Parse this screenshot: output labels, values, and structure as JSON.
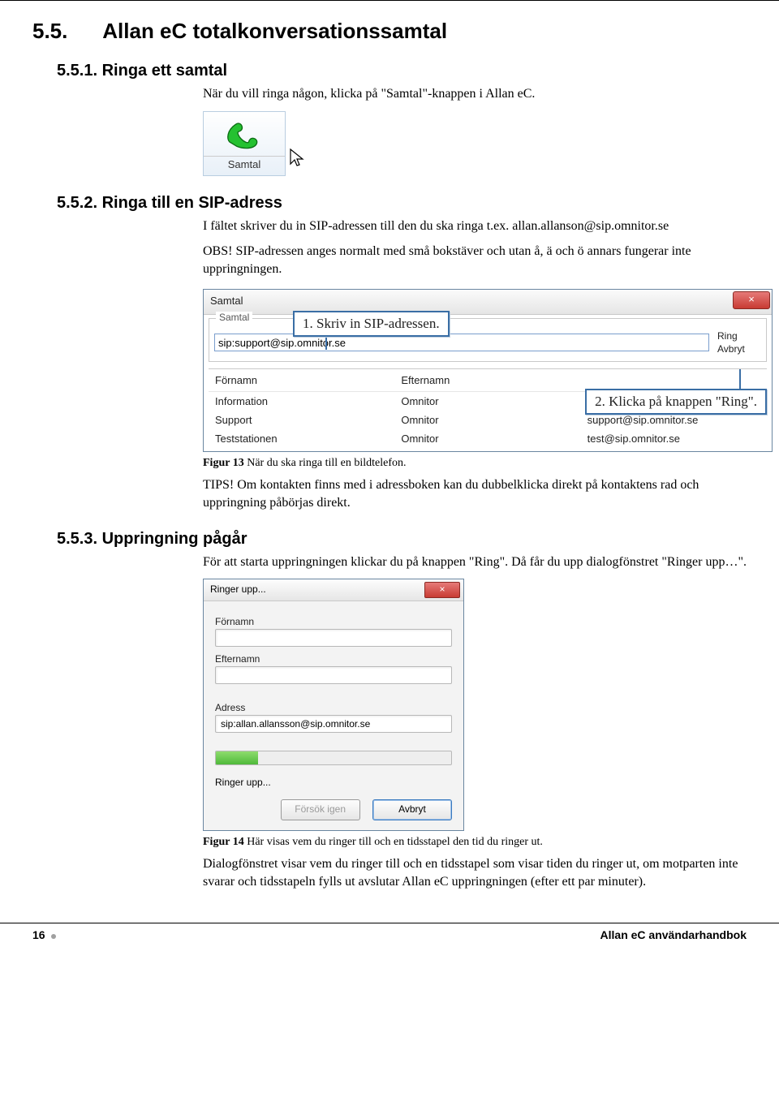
{
  "headings": {
    "h55_num": "5.5.",
    "h55_title": "Allan eC totalkonversationssamtal",
    "h551": "5.5.1. Ringa ett samtal",
    "h552": "5.5.2. Ringa till en SIP-adress",
    "h553": "5.5.3. Uppringning pågår"
  },
  "para": {
    "p1": "När du vill ringa någon, klicka på \"Samtal\"-knappen i Allan eC.",
    "p2a": "I fältet skriver du in SIP-adressen till den du ska ringa t.ex. allan.allanson@sip.omnitor.se",
    "p2b": "OBS! SIP-adressen anges normalt med små bokstäver och utan å, ä och ö annars fungerar inte uppringningen.",
    "tips": "TIPS! Om kontakten finns med i adressboken kan du dubbelklicka direkt på kontaktens rad och uppringning påbörjas direkt.",
    "p3": "För att starta uppringningen klickar du på knappen \"Ring\". Då får du upp dialogfönstret \"Ringer upp…\".",
    "fig13b": "Figur 13",
    "fig13": " När du ska ringa till en bildtelefon.",
    "fig14b": "Figur 14",
    "fig14": " Här visas vem du ringer till och en tidsstapel den tid du ringer ut.",
    "p4": "Dialogfönstret visar vem du ringer till och en tidsstapel som visar tiden du ringer ut, om motparten inte svarar och tidsstapeln fylls ut avslutar Allan eC uppringningen (efter ett par minuter)."
  },
  "samtal_button": {
    "label": "Samtal"
  },
  "callouts": {
    "c1": "1. Skriv in SIP-adressen.",
    "c2": "2. Klicka på knappen \"Ring\"."
  },
  "shot1": {
    "window_title": "Samtal",
    "group_legend": "Samtal",
    "sip_value": "sip:support@sip.omnitor.se",
    "ring": "Ring",
    "avbryt": "Avbryt",
    "headers": {
      "fn": "Förnamn",
      "en": "Efternamn",
      "sp": ""
    },
    "rows": [
      {
        "fn": "Information",
        "en": "Omnitor",
        "sp": ""
      },
      {
        "fn": "Support",
        "en": "Omnitor",
        "sp": "support@sip.omnitor.se"
      },
      {
        "fn": "Teststationen",
        "en": "Omnitor",
        "sp": "test@sip.omnitor.se"
      }
    ],
    "close_x": "×"
  },
  "shot2": {
    "title": "Ringer upp...",
    "close_x": "×",
    "fn_lbl": "Förnamn",
    "en_lbl": "Efternamn",
    "adr_lbl": "Adress",
    "adr_val": "sip:allan.allansson@sip.omnitor.se",
    "status": "Ringer upp...",
    "retry": "Försök igen",
    "cancel": "Avbryt"
  },
  "footer": {
    "page": "16",
    "book": "Allan eC användarhandbok"
  }
}
